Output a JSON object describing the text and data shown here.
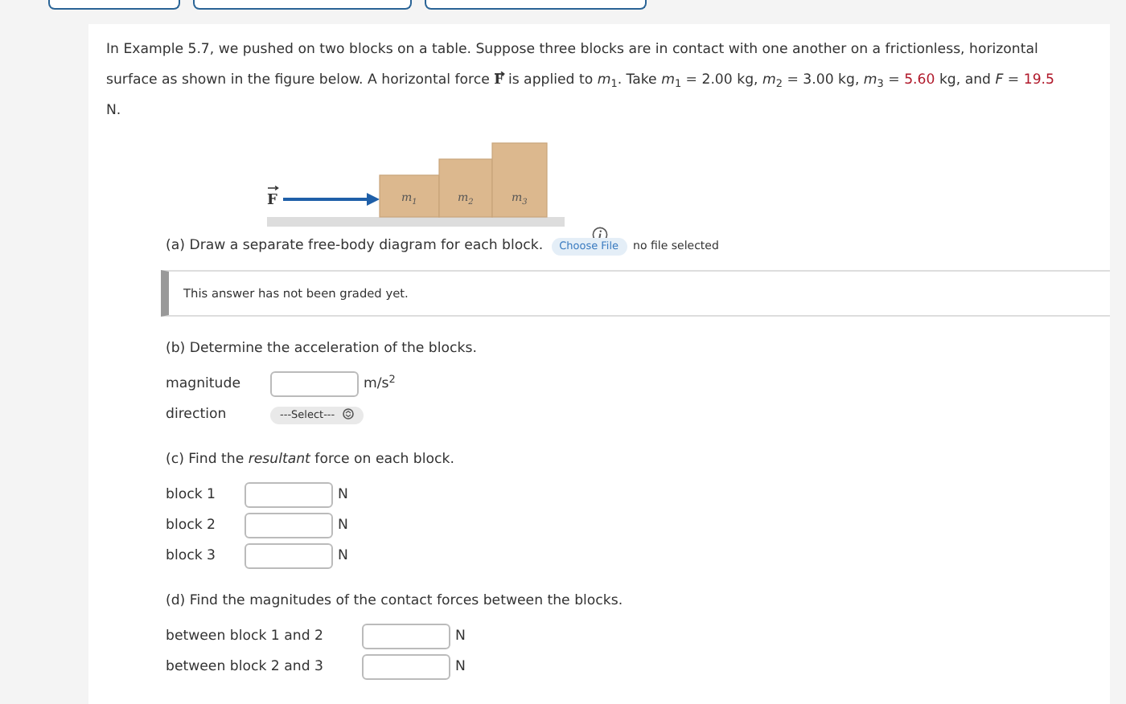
{
  "statement": [
    {
      "kind": "plain",
      "text": "In Example 5.7, we pushed on two blocks on a table. Suppose three blocks are in contact with one another on a frictionless, horizontal surface as shown in the figure below. A horizontal force "
    },
    {
      "kind": "vector",
      "text": "F"
    },
    {
      "kind": "plain",
      "text": " is applied to *m*$_{1}$. Take *m*$_{1}$ = 2.00 kg, *m*$_{2}$ = 3.00 kg, *m*$_{3}$ = "
    },
    {
      "kind": "value",
      "text": "5.60"
    },
    {
      "kind": "plain",
      "text": " kg, and *F* = "
    },
    {
      "kind": "value",
      "text": "19.5"
    },
    {
      "kind": "plain",
      "text": " N."
    }
  ],
  "figure": {
    "force_label": "F",
    "blocks": [
      {
        "label": "m",
        "sub": "1"
      },
      {
        "label": "m",
        "sub": "2"
      },
      {
        "label": "m",
        "sub": "3"
      }
    ]
  },
  "part_a": {
    "prompt": "(a) Draw a separate free-body diagram for each block.",
    "file_button": "Choose File",
    "file_status": "no file selected",
    "feedback": "This answer has not been graded yet."
  },
  "part_b": {
    "prompt": "(b) Determine the acceleration of the blocks.",
    "rows": [
      {
        "kind": "input",
        "label": "magnitude",
        "unit": "m/s$^{2}$"
      },
      {
        "kind": "select",
        "label": "direction",
        "value": "---Select---"
      }
    ]
  },
  "part_c": {
    "prompt": "(c) Find the *resultant* force on each block.",
    "rows": [
      {
        "kind": "input",
        "label": "block 1",
        "unit": "N"
      },
      {
        "kind": "input",
        "label": "block 2",
        "unit": "N"
      },
      {
        "kind": "input",
        "label": "block 3",
        "unit": "N"
      }
    ]
  },
  "part_d": {
    "prompt": "(d) Find the magnitudes of the contact forces between the blocks.",
    "rows": [
      {
        "kind": "input",
        "label": "between block 1 and 2",
        "unit": "N"
      },
      {
        "kind": "input",
        "label": "between block 2 and 3",
        "unit": "N"
      }
    ]
  }
}
